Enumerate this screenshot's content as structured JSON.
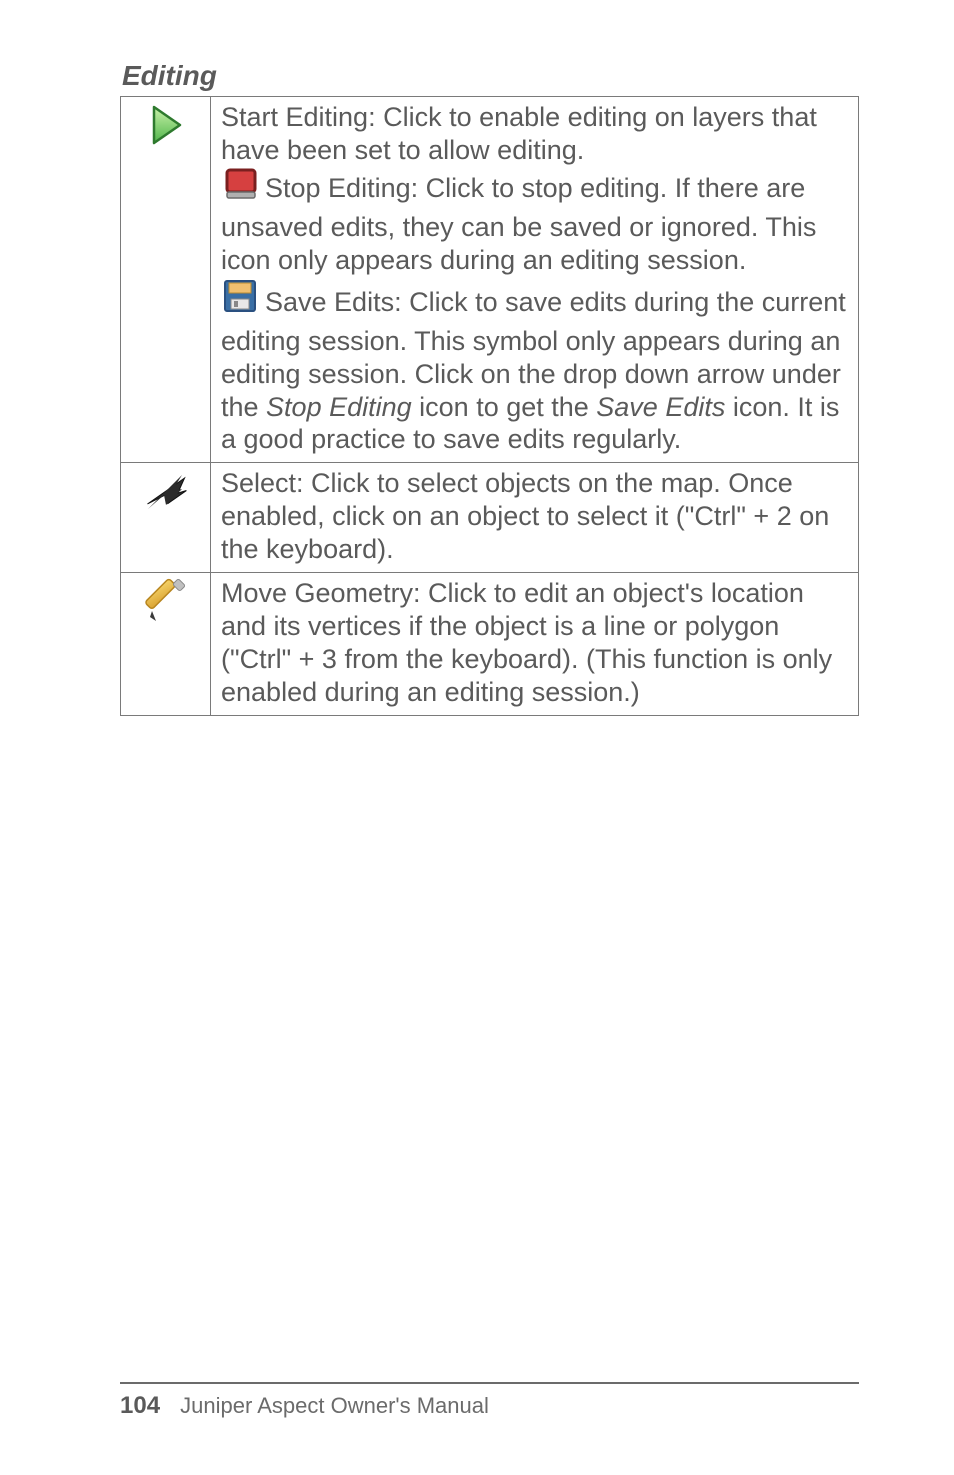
{
  "heading": "Editing",
  "rows": [
    {
      "icon": "start-editing-icon",
      "parts": {
        "p1": "Start Editing: Click to enable editing on layers that have been set to allow editing.",
        "p2a": "Stop Editing: Click to stop editing. If there are unsaved edits, they can be saved or ignored. This icon only appears during an editing session.",
        "p3a": "Save Edits: Click to save edits during the current editing session. This symbol only appears during an editing session. Click on the drop down arrow under the ",
        "p3i1": "Stop Editing",
        "p3b": " icon to get the ",
        "p3i2": "Save Edits",
        "p3c": " icon. It is a good practice to save edits regularly."
      }
    },
    {
      "icon": "select-arrow-icon",
      "text": "Select: Click to select objects on the map. Once enabled, click on an object to select it (\"Ctrl\" + 2 on the keyboard)."
    },
    {
      "icon": "pencil-icon",
      "text": "Move Geometry: Click to edit an object's location and its vertices if the object is a line or polygon (\"Ctrl\" + 3 from the keyboard). (This function is only enabled during an editing session.)"
    }
  ],
  "footer": {
    "page_number": "104",
    "manual_title": "Juniper Aspect Owner's Manual"
  }
}
